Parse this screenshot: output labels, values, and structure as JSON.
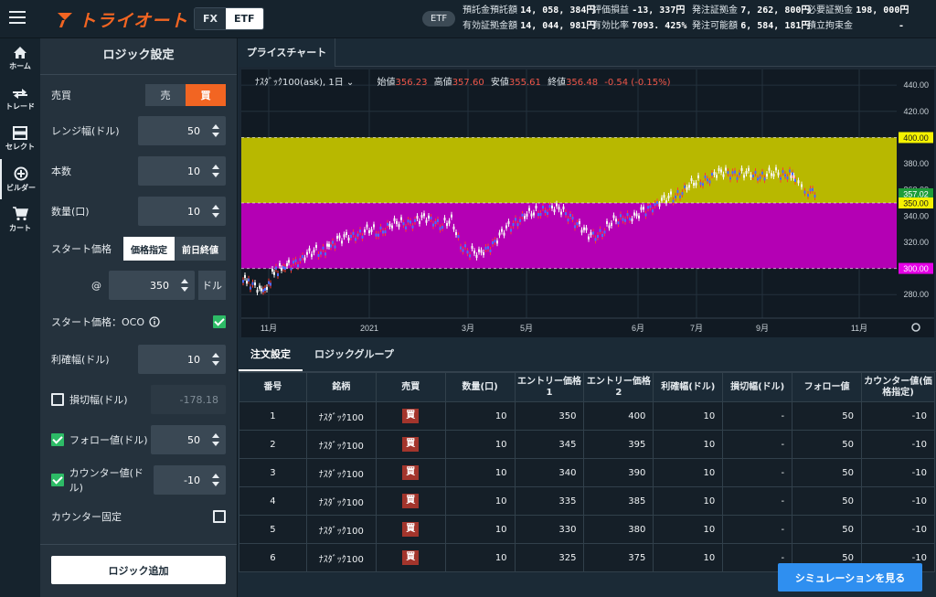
{
  "header": {
    "logo_text": "トライオート",
    "logo_color": "#f26522",
    "product_tabs": [
      {
        "label": "FX",
        "selected": false
      },
      {
        "label": "ETF",
        "selected": true
      }
    ],
    "market_pill": "ETF",
    "account": [
      {
        "label": "預託金預託額",
        "value": "14, 058, 384円"
      },
      {
        "label": "評価損益",
        "value": "-13, 337円"
      },
      {
        "label": "発注証拠金",
        "value": "7, 262, 800円"
      },
      {
        "label": "必要証拠金",
        "value": "198, 000円"
      },
      {
        "label": "有効証拠金額",
        "value": "14, 044, 981円"
      },
      {
        "label": "有効比率",
        "value": "7093. 425%"
      },
      {
        "label": "発注可能額",
        "value": "6, 584, 181円"
      },
      {
        "label": "積立拘束金",
        "value": "-"
      }
    ]
  },
  "nav": {
    "items": [
      {
        "label": "ホーム",
        "icon": "home-icon"
      },
      {
        "label": "トレード",
        "icon": "trade-icon"
      },
      {
        "label": "セレクト",
        "icon": "select-icon"
      },
      {
        "label": "ビルダー",
        "icon": "builder-icon",
        "active": true
      },
      {
        "label": "カート",
        "icon": "cart-icon"
      }
    ]
  },
  "logic": {
    "title": "ロジック設定",
    "side_label": "売買",
    "side_sell": "売",
    "side_buy": "買",
    "range_label": "レンジ幅(ドル)",
    "range_value": "50",
    "count_label": "本数",
    "count_value": "10",
    "qty_label": "数量(口)",
    "qty_value": "10",
    "start_label": "スタート価格",
    "start_opt1": "価格指定",
    "start_opt2": "前日終値",
    "at_sign": "@",
    "start_value": "350",
    "start_unit": "ドル",
    "oco_label": "スタート価格：OCO",
    "oco_checked": true,
    "tp_label": "利確幅(ドル)",
    "tp_value": "10",
    "sl_label": "損切幅(ドル)",
    "sl_placeholder": "-178.18",
    "sl_checked": false,
    "follow_label": "フォロー値(ドル)",
    "follow_value": "50",
    "follow_checked": true,
    "counter_label": "カウンター値(ドル)",
    "counter_value": "-10",
    "counter_checked": true,
    "counter_fix_label": "カウンター固定",
    "counter_fix_checked": false,
    "add_button": "ロジック追加"
  },
  "chart": {
    "tab": "プライスチャート",
    "symbol": "ﾅｽﾀﾞｯｸ100(ask), 1日",
    "open_label": "始値",
    "open": "356.23",
    "high_label": "高値",
    "high": "357.60",
    "low_label": "安値",
    "low": "355.61",
    "close_label": "終値",
    "close": "356.48",
    "change": "-0.54 (-0.15%)",
    "y_ticks": [
      "440.00",
      "420.00",
      "380.00",
      "360.00",
      "340.00",
      "320.00",
      "280.00"
    ],
    "y_tick_values": [
      440,
      420,
      380,
      360,
      340,
      320,
      280
    ],
    "x_ticks": [
      "11月",
      "2021",
      "3月",
      "5月",
      "6月",
      "7月",
      "9月",
      "11月"
    ],
    "tags": [
      {
        "label": "400.00",
        "value": 400,
        "color": "#f5f200",
        "text": "#1a1a1a"
      },
      {
        "label": "357.02",
        "value": 357.02,
        "color": "#1f9d3a",
        "text": "#ffffff"
      },
      {
        "label": "350.00",
        "value": 350,
        "color": "#f5f200",
        "text": "#1a1a1a"
      },
      {
        "label": "300.00",
        "value": 300,
        "color": "#e600e6",
        "text": "#ffffff"
      }
    ],
    "bands": [
      {
        "from": 350,
        "to": 400,
        "color": "#b8b800"
      },
      {
        "from": 300,
        "to": 350,
        "color": "#b400b4"
      }
    ],
    "y_range": [
      262,
      452
    ]
  },
  "orders": {
    "tabs": [
      "注文設定",
      "ロジックグループ"
    ],
    "columns": [
      "番号",
      "銘柄",
      "売買",
      "数量(口)",
      "エントリー価格1",
      "エントリー価格2",
      "利確幅(ドル)",
      "損切幅(ドル)",
      "フォロー値",
      "カウンター値(価格指定)"
    ],
    "rows": [
      [
        "1",
        "ﾅｽﾀﾞｯｸ100",
        "買",
        "10",
        "350",
        "400",
        "10",
        "-",
        "50",
        "-10"
      ],
      [
        "2",
        "ﾅｽﾀﾞｯｸ100",
        "買",
        "10",
        "345",
        "395",
        "10",
        "-",
        "50",
        "-10"
      ],
      [
        "3",
        "ﾅｽﾀﾞｯｸ100",
        "買",
        "10",
        "340",
        "390",
        "10",
        "-",
        "50",
        "-10"
      ],
      [
        "4",
        "ﾅｽﾀﾞｯｸ100",
        "買",
        "10",
        "335",
        "385",
        "10",
        "-",
        "50",
        "-10"
      ],
      [
        "5",
        "ﾅｽﾀﾞｯｸ100",
        "買",
        "10",
        "330",
        "380",
        "10",
        "-",
        "50",
        "-10"
      ],
      [
        "6",
        "ﾅｽﾀﾞｯｸ100",
        "買",
        "10",
        "325",
        "375",
        "10",
        "-",
        "50",
        "-10"
      ]
    ],
    "sim_button": "シミュレーションを見る"
  }
}
